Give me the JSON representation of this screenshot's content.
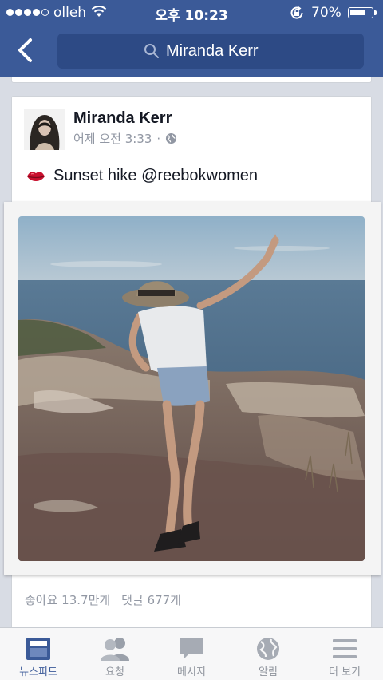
{
  "status_bar": {
    "carrier": "olleh",
    "time": "오후 10:23",
    "battery": "70%",
    "battery_level": 0.7
  },
  "header": {
    "search_value": "Miranda Kerr",
    "back_icon": "chevron-left-icon",
    "search_icon": "search-icon"
  },
  "post": {
    "author": "Miranda Kerr",
    "time": "어제 오전 3:33",
    "separator": "·",
    "privacy_icon": "globe-icon",
    "emoji": "kiss-mark",
    "text": "Sunset hike @reebokwomen",
    "likes": "좋아요 13.7만개",
    "comments": "댓글 677개"
  },
  "tabs": [
    {
      "label": "뉴스피드",
      "icon": "news-feed-icon",
      "active": true
    },
    {
      "label": "요청",
      "icon": "friend-requests-icon",
      "active": false
    },
    {
      "label": "메시지",
      "icon": "messages-icon",
      "active": false
    },
    {
      "label": "알림",
      "icon": "notifications-globe-icon",
      "active": false
    },
    {
      "label": "더 보기",
      "icon": "more-menu-icon",
      "active": false
    }
  ],
  "colors": {
    "brand": "#3b5a98",
    "tab_inactive": "#8e939c",
    "background": "#d8dce4"
  }
}
